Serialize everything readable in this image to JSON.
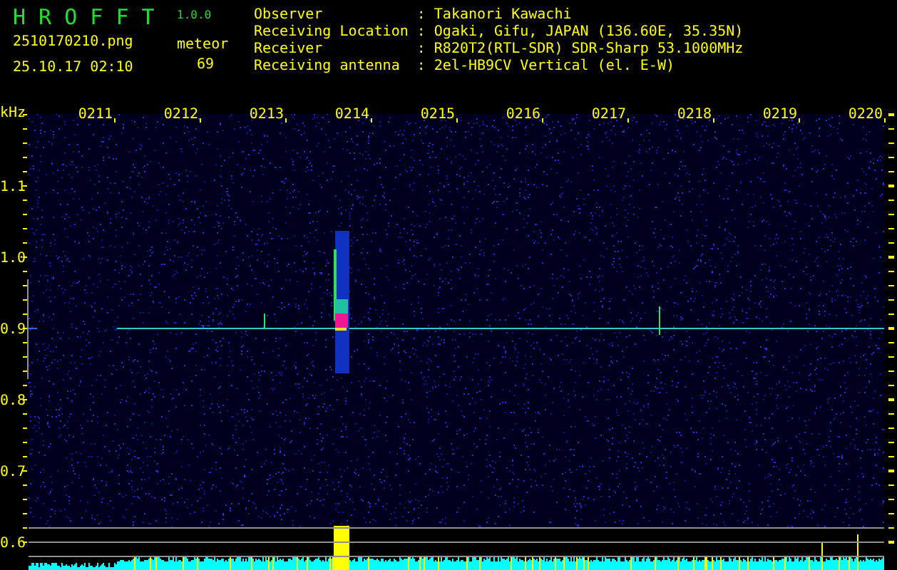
{
  "app": {
    "title": "H R O F F T",
    "version": "1.0.0"
  },
  "file": {
    "name": "2510170210.png",
    "timestamp": "25.10.17 02:10"
  },
  "detection": {
    "label": "meteor",
    "count": "69"
  },
  "station": [
    {
      "label": "Observer",
      "separator": ":",
      "value": "Takanori Kawachi"
    },
    {
      "label": "Receiving Location",
      "separator": ":",
      "value": "Ogaki, Gifu, JAPAN (136.60E, 35.35N)"
    },
    {
      "label": "Receiver",
      "separator": ":",
      "value": "R820T2(RTL-SDR) SDR-Sharp 53.1000MHz"
    },
    {
      "label": "Receiving antenna",
      "separator": ":",
      "value": "2el-HB9CV Vertical (el. E-W)"
    }
  ],
  "plot": {
    "y_unit": "kHz",
    "y_labels": [
      "1.1",
      "1.0",
      "0.9",
      "0.8",
      "0.7",
      "0.6"
    ],
    "time_labels": [
      "0211",
      "0212",
      "0213",
      "0214",
      "0215",
      "0216",
      "0217",
      "0218",
      "0219",
      "0220"
    ]
  }
}
